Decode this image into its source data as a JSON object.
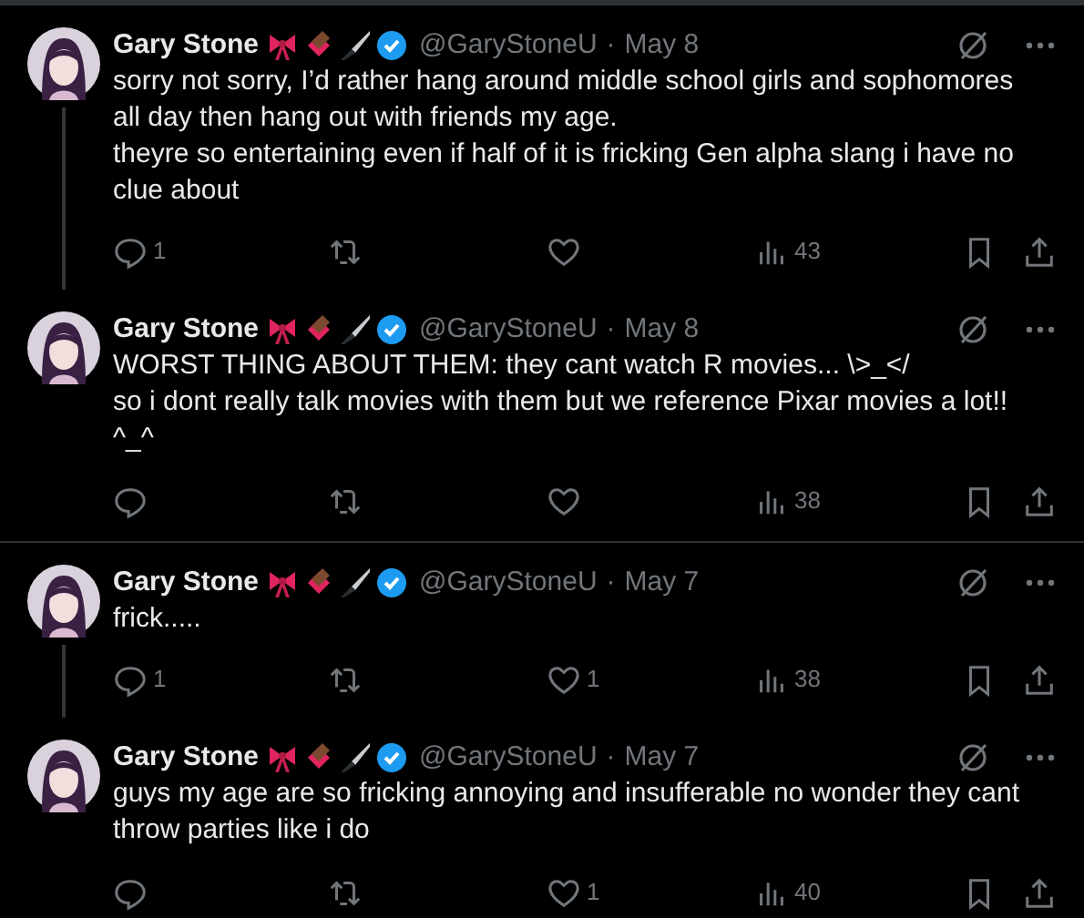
{
  "posts": [
    {
      "name": "Gary Stone",
      "handle": "@GaryStoneU",
      "separator": "·",
      "date": "May 8",
      "lines": [
        "sorry not sorry, I’d rather hang around middle school girls and sophomores all day then hang out with friends my age.",
        "theyre so entertaining even if half of it is fricking Gen alpha slang i have no clue about"
      ],
      "thread_continues": true,
      "replies": "1",
      "views": "43"
    },
    {
      "name": "Gary Stone",
      "handle": "@GaryStoneU",
      "separator": "·",
      "date": "May 8",
      "lines": [
        "WORST THING ABOUT THEM: they cant watch R movies... \\>_</",
        "so i dont really talk movies with them but we reference Pixar movies a lot!! ^_^"
      ],
      "thread_continues": false,
      "views": "38"
    },
    {
      "name": "Gary Stone",
      "handle": "@GaryStoneU",
      "separator": "·",
      "date": "May 7",
      "lines": [
        "frick....."
      ],
      "thread_continues": true,
      "replies": "1",
      "likes": "1",
      "views": "38"
    },
    {
      "name": "Gary Stone",
      "handle": "@GaryStoneU",
      "separator": "·",
      "date": "May 7",
      "lines": [
        "guys my age are so fricking annoying and insufferable no wonder they cant throw parties like i do"
      ],
      "thread_continues": false,
      "likes": "1",
      "views": "40"
    }
  ]
}
